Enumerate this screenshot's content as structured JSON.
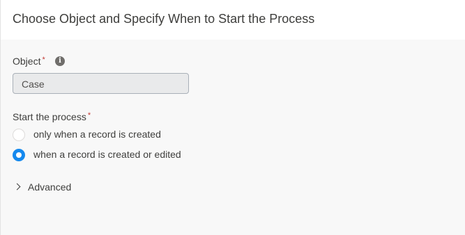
{
  "header": {
    "title": "Choose Object and Specify When to Start the Process"
  },
  "object_field": {
    "label": "Object",
    "required_marker": "*",
    "info_icon": "info-icon",
    "info_glyph": "i",
    "value": "Case"
  },
  "start_field": {
    "label": "Start the process",
    "required_marker": "*",
    "options": [
      {
        "label": "only when a record is created",
        "selected": false
      },
      {
        "label": "when a record is created or edited",
        "selected": true
      }
    ]
  },
  "advanced": {
    "label": "Advanced",
    "icon": "chevron-right-icon"
  },
  "colors": {
    "accent": "#1589ee",
    "required": "#c23934"
  }
}
